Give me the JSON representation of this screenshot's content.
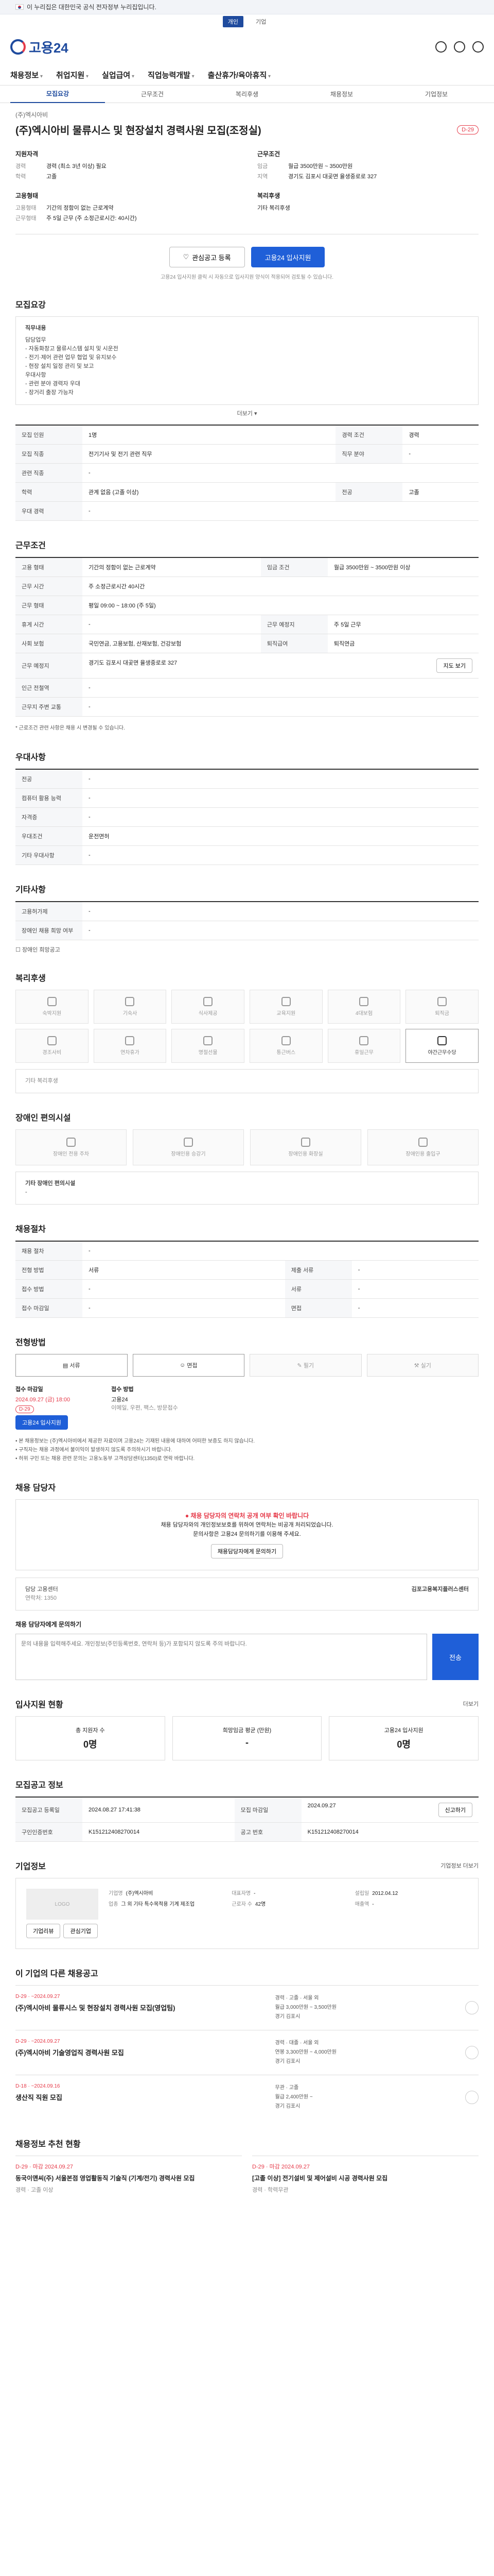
{
  "gov_bar": {
    "text": "이 누리집은 대한민국 공식 전자정부 누리집입니다."
  },
  "util_tabs": [
    "개인",
    "기업"
  ],
  "logo_text": "고용24",
  "gnb": [
    "채용정보",
    "취업지원",
    "실업급여",
    "직업능력개발",
    "출산휴가/육아휴직"
  ],
  "sub_tabs": [
    "모집요강",
    "근무조건",
    "복리후생",
    "채용정보",
    "기업정보"
  ],
  "job": {
    "company": "(주)엑시아비",
    "title": "(주)엑시아비 물류시스 및 현장설치 경력사원 모집(조정실)",
    "dday": "D-29",
    "summary": {
      "qualify_h": "지원자격",
      "qualify": [
        {
          "k": "경력",
          "v": "경력 (최소 3년 이상) 필요"
        },
        {
          "k": "학력",
          "v": "고졸"
        }
      ],
      "cond_h": "근무조건",
      "cond": [
        {
          "k": "임금",
          "v": "월급 3500만원 ~ 3500만원"
        },
        {
          "k": "지역",
          "v": "경기도 김포시 대곶면 율생중로로 327"
        }
      ],
      "type_h": "고용형태",
      "type": [
        {
          "k": "고용형태",
          "v": "기간의 정함이 없는 근로계약"
        },
        {
          "k": "근무형태",
          "v": "주 5일 근무 (주 소정근로시간: 40시간)"
        }
      ],
      "welfare_h": "복리후생",
      "welfare": [
        {
          "k": "",
          "v": "기타 복리후생"
        }
      ]
    }
  },
  "apply": {
    "scrap": "관심공고 등록",
    "apply": "고용24 입사지원",
    "note": "고용24 입사지원 클릭 시 자동으로 입사지원 양식이 적용되어 검토될 수 있습니다."
  },
  "recruit": {
    "title": "모집요강",
    "job_desc_h": "직무내용",
    "job_desc": [
      "담당업무",
      "- 자동화창고 물류시스템 설치 및 시운전",
      "- 전기·제어 관련 업무 협업 및 유지보수",
      "- 현장 설치 일정 관리 및 보고",
      "우대사항",
      "- 관련 분야 경력자 우대",
      "- 장거리 출장 가능자"
    ],
    "more": "더보기",
    "rows": [
      {
        "k": "모집 인원",
        "v": "1명",
        "k2": "경력 조건",
        "v2": "경력"
      },
      {
        "k": "모집 직종",
        "v": "전기기사 및 전기 관련 직무",
        "k2": "직무 분야",
        "v2": "-"
      },
      {
        "k": "관련 직종",
        "v": "-",
        "k2": "",
        "v2": ""
      },
      {
        "k": "학력",
        "v": "관계 없음 (고졸 이상)",
        "k2": "전공",
        "v2": "고졸"
      },
      {
        "k": "우대 경력",
        "v": "-",
        "k2": "",
        "v2": ""
      }
    ]
  },
  "work": {
    "title": "근무조건",
    "rows": [
      {
        "k": "고용 형태",
        "v": "기간의 정함이 없는 근로계약",
        "k2": "임금 조건",
        "v2": "월급 3500만원 ~ 3500만원 이상"
      },
      {
        "k": "근무 시간",
        "v": "주 소정근로시간 40시간",
        "k2": "",
        "v2": ""
      },
      {
        "k": "근무 형태",
        "v": "평일 09:00 ~ 18:00 (주 5일)",
        "k2": "",
        "v2": ""
      },
      {
        "k": "휴게 시간",
        "v": "-",
        "k2": "근무 예정지",
        "v2": "주 5일 근무"
      },
      {
        "k": "사회 보험",
        "v": "국민연금, 고용보험, 산재보험, 건강보험",
        "k2": "퇴직급여",
        "v2": "퇴직연금"
      },
      {
        "k": "근무 예정지",
        "v": "경기도 김포시 대곶면 율생중로로 327",
        "k2": "",
        "v2": ""
      },
      {
        "k": "인근 전철역",
        "v": "-",
        "k2": "",
        "v2": ""
      },
      {
        "k": "근무지 주변 교통",
        "v": "-",
        "k2": "",
        "v2": ""
      }
    ],
    "map_btn": "지도 보기",
    "note": "* 근로조건 관련 사항은 채용 시 변경될 수 있습니다."
  },
  "pref": {
    "title": "우대사항",
    "rows": [
      {
        "k": "전공",
        "v": "-"
      },
      {
        "k": "컴퓨터 활용 능력",
        "v": "-"
      },
      {
        "k": "자격증",
        "v": "-"
      },
      {
        "k": "우대조건",
        "v": "운전면허"
      },
      {
        "k": "기타 우대사항",
        "v": "-"
      }
    ]
  },
  "etc": {
    "title": "기타사항",
    "rows": [
      {
        "k": "고용허가제",
        "v": "-"
      },
      {
        "k": "장애인 채용 희망 여부",
        "v": "-"
      }
    ],
    "check": "장애인 희망공고"
  },
  "welfare": {
    "title": "복리후생",
    "items": [
      "숙박지원",
      "기숙사",
      "식사제공",
      "교육지원",
      "4대보험",
      "퇴직금",
      "경조사비",
      "연차휴가",
      "명절선물",
      "통근버스",
      "휴일근무",
      "야간근무수당"
    ]
  },
  "disability": {
    "title": "장애인 편의시설",
    "items": [
      "장애인 전용 주차",
      "장애인용 승강기",
      "장애인용 화장실",
      "장애인용 출입구"
    ],
    "other_h": "기타 장애인 편의시설",
    "other_v": "-"
  },
  "hire": {
    "title": "채용절차",
    "rows": [
      {
        "k": "채용 절차",
        "v": "-",
        "k2": "",
        "v2": ""
      },
      {
        "k": "전형 방법",
        "v": "서류",
        "k2": "제출 서류",
        "v2": "-"
      },
      {
        "k": "접수 방법",
        "v": "-",
        "k2": "서류",
        "v2": "-"
      },
      {
        "k": "접수 마감일",
        "v": "-",
        "k2": "면접",
        "v2": "-"
      }
    ]
  },
  "method": {
    "title": "전형방법",
    "items": [
      "서류",
      "면접",
      "필기",
      "실기"
    ],
    "deadline_h": "접수 마감일",
    "deadline": "2024.09.27 (금) 18:00",
    "dday": "D-29",
    "apply": "고용24 입사지원",
    "submit_h": "접수 방법",
    "submit_v": "고용24",
    "submit_v2": "이메일, 우편, 팩스, 방문접수",
    "warnings": [
      "• 본 채용정보는 (주)엑시아비에서 제공한 자료이며 고용24는 기재된 내용에 대하여 어떠한 보증도 하지 않습니다.",
      "• 구직자는 채용 과정에서 불이익이 발생하지 않도록 주의하시기 바랍니다.",
      "• 허위 구인 또는 채용 관련 문의는 고용노동부 고객상담센터(1350)로 연락 바랍니다."
    ]
  },
  "contact": {
    "title": "채용 담당자",
    "alert": "채용 담당자의 연락처 공개 여부 확인 바랍니다",
    "line1": "채용 담당자와의 개인정보보호를 위하여 연락처는 비공개 처리되었습니다.",
    "line2": "문의사항은 고용24 문의하기를 이용해 주세요.",
    "btn": "채용담당자에게 문의하기",
    "agent_label": "담당 고용센터",
    "agent_name": "김포고용복지플러스센터",
    "agent_phone": "연락처: 1350",
    "qa_h": "채용 담당자에게 문의하기",
    "qa_placeholder": "문의 내용을 입력해주세요. 개인정보(주민등록번호, 연락처 등)가 포함되지 않도록 주의 바랍니다.",
    "qa_send": "전송"
  },
  "stats": {
    "title": "입사지원 현황",
    "link": "더보기",
    "cards": [
      {
        "label": "총 지원자 수",
        "num": "0명"
      },
      {
        "label": "희망임금 평균 (만원)",
        "num": "-"
      },
      {
        "label": "고용24 입사지원",
        "num": "0명"
      }
    ]
  },
  "info": {
    "title": "모집공고 정보",
    "rows": [
      {
        "k": "모집공고 등록일",
        "v": "2024.08.27 17:41:38",
        "k2": "모집 마감일",
        "v2": "2024.09.27"
      },
      {
        "k": "구인인증번호",
        "v": "K151212408270014",
        "k2": "공고 번호",
        "v2": "K151212408270014"
      }
    ],
    "report_btn": "신고하기"
  },
  "company": {
    "title": "기업정보",
    "link": "기업정보 더보기",
    "logo_alt": "LOGO",
    "info": [
      {
        "k": "기업명",
        "v": "(주)엑시아비"
      },
      {
        "k": "대표자명",
        "v": "-"
      },
      {
        "k": "업종",
        "v": "그 외 기타 특수목적용 기계 제조업"
      },
      {
        "k": "설립일",
        "v": "2012.04.12"
      },
      {
        "k": "근로자 수",
        "v": "42명"
      },
      {
        "k": "매출액",
        "v": "-"
      }
    ],
    "btn1": "기업리뷰",
    "btn2": "관심기업"
  },
  "other_jobs": {
    "title": "이 기업의 다른 채용공고",
    "items": [
      {
        "meta": "D-29 · ~2024.09.27",
        "name": "(주)엑시아비 물류시스 및 현장설치 경력사원 모집(영업팀)",
        "c1": "경력 · 고졸 · 서울 외",
        "c2": "월급 3,000만원 ~ 3,500만원",
        "c3": "경기 김포시"
      },
      {
        "meta": "D-29 · ~2024.09.27",
        "name": "(주)엑시아비 기술영업직 경력사원 모집",
        "c1": "경력 · 대졸 · 서울 외",
        "c2": "연봉 3,300만원 ~ 4,000만원",
        "c3": "경기 김포시"
      },
      {
        "meta": "D-18 · ~2024.09.16",
        "name": "생산직 직원 모집",
        "c1": "무관 · 고졸",
        "c2": "월급 2,400만원 ~",
        "c3": "경기 김포시"
      }
    ]
  },
  "reco": {
    "title": "채용정보 추천 현황",
    "items": [
      {
        "meta": "D-29 · 마감 2024.09.27",
        "name": "동국이앤씨(주) 서울본점 영업활동직 기술직 (기계/전기) 경력사원 모집",
        "sub": "경력 · 고졸 이상"
      },
      {
        "meta": "D-29 · 마감 2024.09.27",
        "name": "[고졸 이상] 전기설비 및 제어설비 시공 경력사원 모집",
        "sub": "경력 · 학력무관"
      }
    ]
  }
}
